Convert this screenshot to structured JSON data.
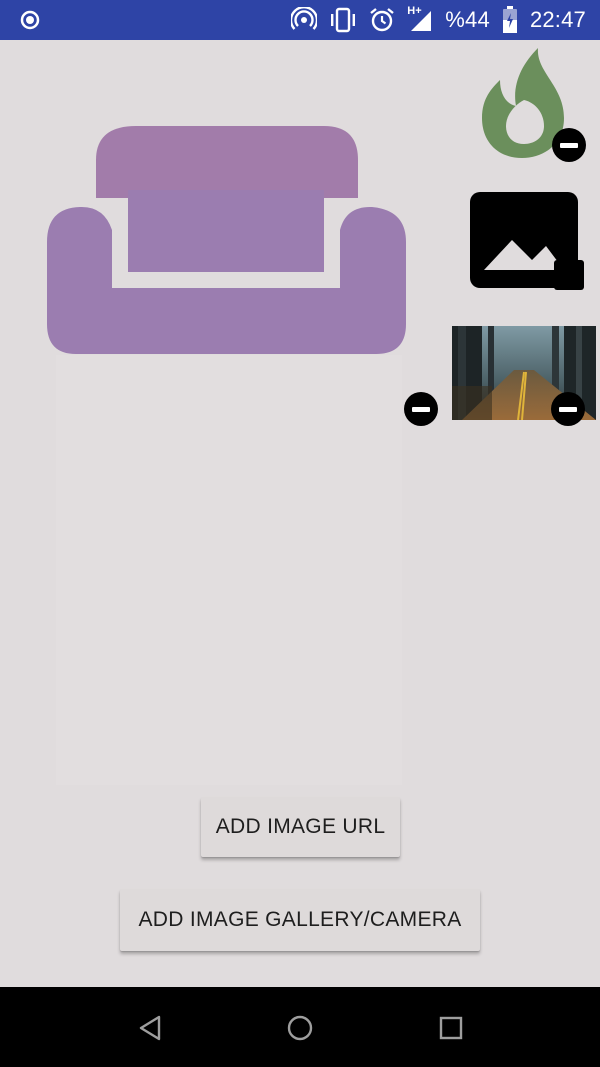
{
  "status_bar": {
    "battery_text": "%44",
    "time": "22:47",
    "network_label": "H+",
    "background_color": "#2e44a6"
  },
  "icons": {
    "status_left": "radio-button-icon",
    "hotspot": "hotspot-icon",
    "vibrate": "vibrate-icon",
    "alarm": "alarm-icon",
    "signal": "signal-icon",
    "battery": "battery-charging-icon",
    "sofa": "sofa-icon",
    "fire": "fire-icon",
    "image_placeholder": "image-placeholder-icon",
    "remove": "remove-circle-icon",
    "back": "back-triangle-icon",
    "home": "home-circle-icon",
    "recent": "recent-square-icon"
  },
  "colors": {
    "sofa": "#9b7db0",
    "sofa_back": "#a27caa",
    "fire": "#6b8f5c",
    "background": "#e0dcdd"
  },
  "buttons": {
    "add_url": "ADD IMAGE URL",
    "add_gallery": "ADD IMAGE GALLERY/CAMERA"
  }
}
